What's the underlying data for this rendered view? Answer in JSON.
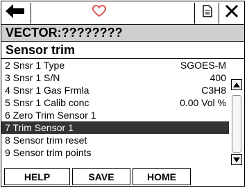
{
  "toolbar": {
    "back_icon": "left-arrow-icon",
    "favorite_icon": "heart-icon",
    "document_icon": "document-icon",
    "close_icon": "close-icon"
  },
  "header": {
    "device_title": "VECTOR:????????",
    "section_title": "Sensor trim"
  },
  "list": {
    "items": [
      {
        "label": "2 Snsr 1 Type",
        "value": "SGOES-M"
      },
      {
        "label": "3 Snsr 1 S/N",
        "value": "400"
      },
      {
        "label": "4 Snsr 1 Gas Frmla",
        "value": "C3H8"
      },
      {
        "label": "5 Snsr 1 Calib conc",
        "value": "0.00 Vol %"
      },
      {
        "label": "6 Zero Trim Sensor 1",
        "value": ""
      },
      {
        "label": "7 Trim Sensor 1",
        "value": ""
      },
      {
        "label": "8 Sensor trim reset",
        "value": ""
      },
      {
        "label": "9 Sensor trim points",
        "value": ""
      }
    ],
    "selected_index": 5
  },
  "buttons": {
    "help": "HELP",
    "save": "SAVE",
    "home": "HOME"
  },
  "colors": {
    "title_bar": "#cfcfcf",
    "selection": "#333333",
    "heart": "#d9534f"
  }
}
